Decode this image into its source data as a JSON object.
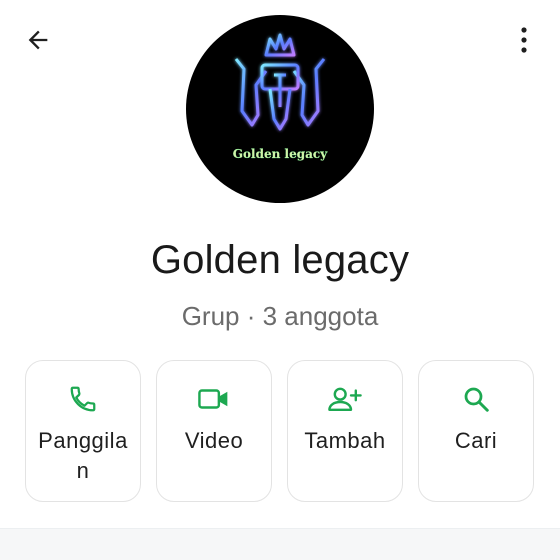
{
  "header": {
    "back_icon": "arrow-left-icon",
    "menu_icon": "more-vert-icon"
  },
  "group": {
    "avatar_logo_text": "Golden legacy",
    "name": "Golden legacy",
    "meta": "Grup · 3 anggota"
  },
  "actions": [
    {
      "label": "Panggilan",
      "icon": "phone-icon"
    },
    {
      "label": "Video",
      "icon": "video-icon"
    },
    {
      "label": "Tambah",
      "icon": "add-person-icon"
    },
    {
      "label": "Cari",
      "icon": "search-icon"
    }
  ],
  "colors": {
    "accent": "#1da851",
    "text_primary": "#1a1a1a",
    "text_secondary": "#6b6b6b",
    "card_border": "#e3e3e3"
  }
}
